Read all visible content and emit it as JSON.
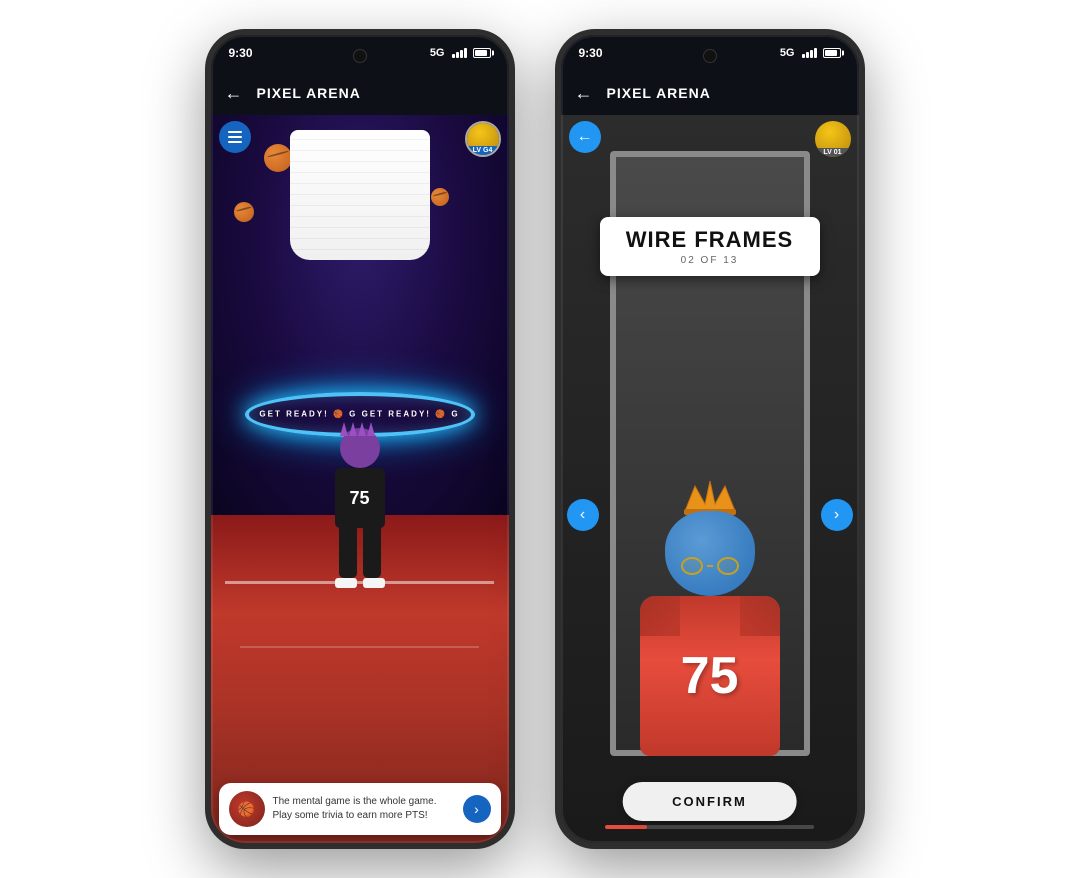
{
  "scene": {
    "background": "#f0f0f0"
  },
  "phone1": {
    "status": {
      "time": "9:30",
      "signal": "5G",
      "battery": "75"
    },
    "appBar": {
      "backLabel": "←",
      "title": "PIXEL ARENA"
    },
    "levelBadge": "LV G4",
    "ring": {
      "text": "GET READY! 🏀 G GET READY! 🏀 G"
    },
    "character": {
      "jerseyNumber": "75"
    },
    "chat": {
      "message": "The mental game is the whole game. Play some trivia to earn more PTS!",
      "buttonLabel": "›"
    }
  },
  "phone2": {
    "status": {
      "time": "9:30",
      "signal": "5G"
    },
    "appBar": {
      "backLabel": "←",
      "title": "PIXEL ARENA"
    },
    "levelBadge": "LV 01",
    "titleCard": {
      "main": "WIRE FRAMES",
      "sub": "02 OF 13"
    },
    "character": {
      "jerseyNumber": "75"
    },
    "navLeft": "‹",
    "navRight": "›",
    "confirmButton": "CONFIRM",
    "progressPercent": 20
  }
}
